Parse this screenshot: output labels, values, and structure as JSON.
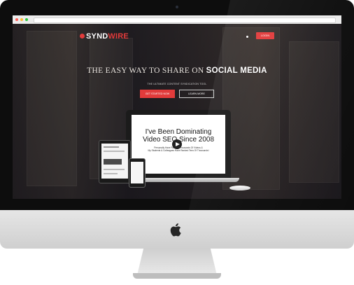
{
  "site": {
    "logo_prefix": "SYND",
    "logo_suffix": "WIRE",
    "login_label": "LOGIN",
    "headline_light": "THE EASY WAY TO SHARE ON ",
    "headline_strong": "SOCIAL MEDIA",
    "subline": "THE ULTIMATE CONTENT SYNDICATION TOOL",
    "cta_primary": "GET STARTED NOW",
    "cta_secondary": "LEARN MORE"
  },
  "video": {
    "title_line1": "I've Been Dominating",
    "title_line2": "Video SEO Since 2008",
    "sub_line1": "Personally Have Ranked Thousands Of Videos &",
    "sub_line2": "My Students & Colleagues Have Ranked Tens Of Thousands!"
  },
  "colors": {
    "accent": "#e23b3b",
    "frame": "#0d0d0d",
    "chin": "#d9d9d9"
  },
  "icons": {
    "play": "play-icon",
    "apple": "apple-logo-icon",
    "logo": "syndwire-logo-icon"
  }
}
